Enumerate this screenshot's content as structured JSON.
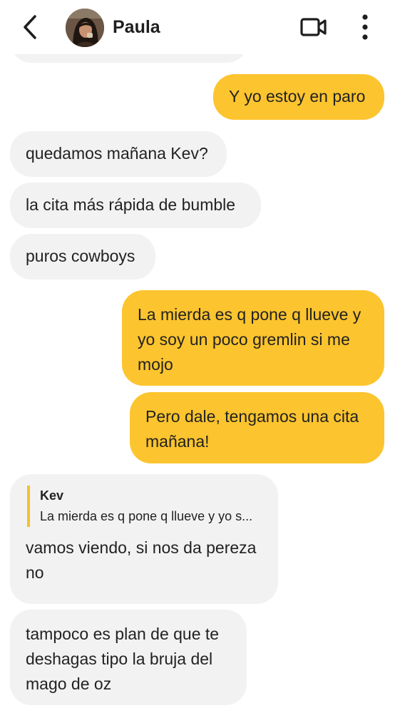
{
  "header": {
    "contact_name": "Paula"
  },
  "messages": [
    {
      "side": "outgoing",
      "text": "Y yo estoy en paro"
    },
    {
      "side": "incoming",
      "text": "quedamos mañana Kev?"
    },
    {
      "side": "incoming",
      "text": "la cita más rápida de bumble"
    },
    {
      "side": "incoming",
      "text": "puros cowboys"
    },
    {
      "side": "outgoing",
      "text": "La mierda es q pone q llueve y yo soy un poco gremlin si me mojo"
    },
    {
      "side": "outgoing",
      "text": "Pero dale, tengamos una cita mañana!"
    },
    {
      "side": "incoming",
      "reply_to": {
        "author": "Kev",
        "text": "La mierda es q pone q llueve y yo s..."
      },
      "text": "vamos viendo, si nos da pereza no"
    },
    {
      "side": "incoming",
      "text": "tampoco es plan de que te deshagas tipo la bruja del mago de oz"
    }
  ],
  "colors": {
    "outgoing_bubble": "#fcc42e",
    "incoming_bubble": "#f2f2f2",
    "quote_bar": "#f3c12c"
  },
  "icons": [
    "back-chevron-icon",
    "video-call-icon",
    "more-options-icon"
  ]
}
